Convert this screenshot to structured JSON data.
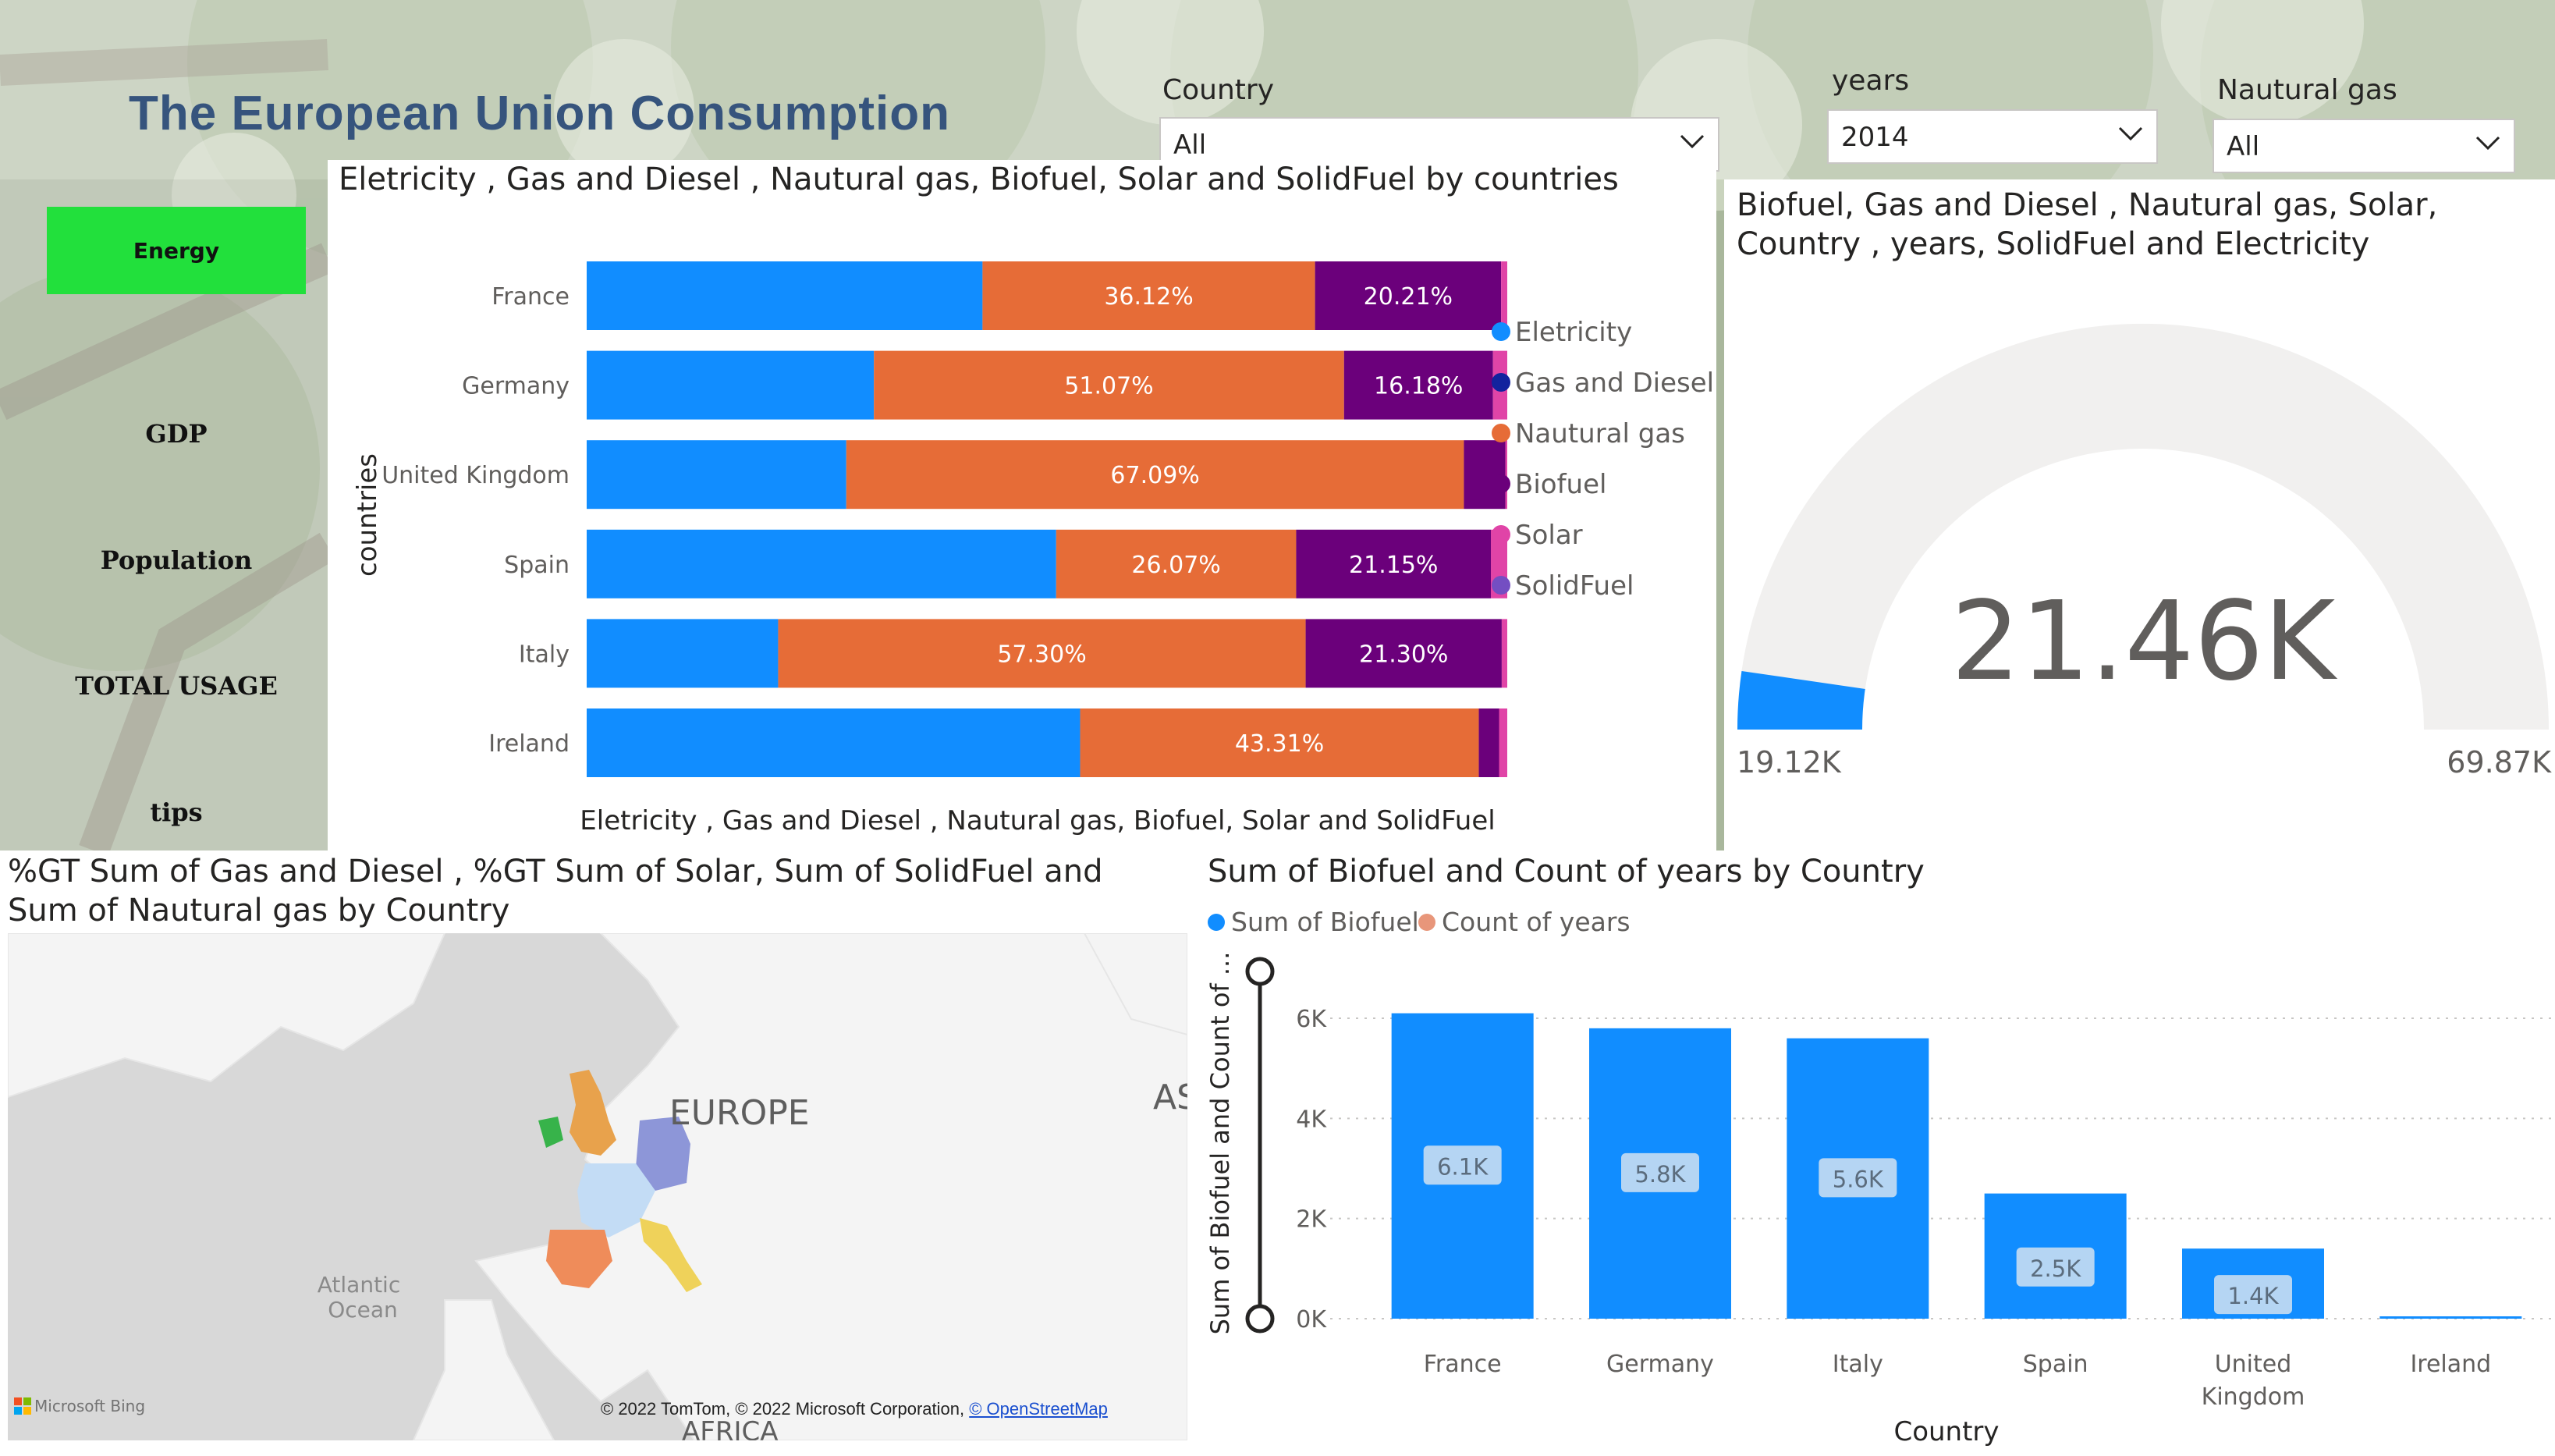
{
  "header": {
    "title": "The European Union Consumption"
  },
  "slicers": {
    "country": {
      "label": "Country",
      "value": "All"
    },
    "years": {
      "label": "years",
      "value": "2014"
    },
    "natural_gas": {
      "label": "Nautural gas",
      "value": "All"
    }
  },
  "nav": {
    "items": [
      "Energy",
      "GDP",
      "Population",
      "TOTAL USAGE",
      "tips"
    ],
    "active": "Energy",
    "active_color": "#22e03c"
  },
  "stacked": {
    "title": "Eletricity , Gas and Diesel , Nautural gas, Biofuel, Solar and SolidFuel by countries",
    "ylabel": "countries",
    "xlabel": "Eletricity , Gas and Diesel , Nautural gas, Biofuel, Solar and SolidFuel",
    "legend": [
      "Eletricity",
      "Gas and Diesel",
      "Nautural gas",
      "Biofuel",
      "Solar",
      "SolidFuel"
    ]
  },
  "gauge": {
    "title": "Biofuel, Gas and Diesel , Nautural gas, Solar, Country , years, SolidFuel and Electricity",
    "value": "21.46K",
    "min": "19.12K",
    "max": "69.87K",
    "value_num": 21460,
    "min_num": 19120,
    "max_num": 69870
  },
  "map": {
    "title": "%GT Sum of Gas and Diesel , %GT Sum of Solar, Sum of SolidFuel and Sum of Nautural gas by Country",
    "labels": {
      "europe": "EUROPE",
      "asia": "AS",
      "ocean1": "Atlantic",
      "ocean2": "Ocean",
      "africa": "AFRICA"
    },
    "bing": "Microsoft Bing",
    "credit": "© 2022 TomTom, © 2022 Microsoft Corporation, ",
    "credit_link": "© OpenStreetMap"
  },
  "bar": {
    "title": "Sum of Biofuel and Count of years by Country",
    "legend": [
      "Sum of Biofuel",
      "Count of years"
    ],
    "ylabel": "Sum of Biofuel and Count of ...",
    "xlabel": "Country"
  },
  "chart_data": [
    {
      "type": "bar",
      "orientation": "horizontal-stacked-100",
      "categories": [
        "France",
        "Germany",
        "United Kingdom",
        "Spain",
        "Italy",
        "Ireland"
      ],
      "series": [
        {
          "name": "Eletricity",
          "color": "#118dff",
          "values": [
            43.0,
            31.2,
            28.2,
            51.0,
            20.8,
            53.6
          ]
        },
        {
          "name": "Gas and Diesel",
          "color": "#12239e",
          "values": [
            0,
            0,
            0,
            0,
            0,
            0
          ]
        },
        {
          "name": "Nautural gas",
          "color": "#e66c37",
          "values": [
            36.12,
            51.07,
            67.09,
            26.07,
            57.3,
            43.31
          ]
        },
        {
          "name": "Biofuel",
          "color": "#6b007b",
          "values": [
            20.21,
            16.18,
            4.5,
            21.15,
            21.3,
            2.2
          ]
        },
        {
          "name": "Solar",
          "color": "#e044a7",
          "values": [
            0.67,
            1.55,
            0.21,
            1.78,
            0.6,
            0.89
          ]
        },
        {
          "name": "SolidFuel",
          "color": "#744ec2",
          "values": [
            0,
            0,
            0,
            0,
            0,
            0
          ]
        }
      ],
      "data_labels": [
        [
          "",
          "36.12%",
          "20.21%"
        ],
        [
          "",
          "51.07%",
          "16.18%"
        ],
        [
          "",
          "67.09%",
          ""
        ],
        [
          "",
          "26.07%",
          "21.15%"
        ],
        [
          "",
          "57.30%",
          "21.30%"
        ],
        [
          "",
          "43.31%",
          ""
        ]
      ],
      "legend_position": "right"
    },
    {
      "type": "bar",
      "categories": [
        "France",
        "Germany",
        "Italy",
        "Spain",
        "United Kingdom",
        "Ireland"
      ],
      "series": [
        {
          "name": "Sum of Biofuel",
          "color": "#118dff",
          "values": [
            6100,
            5800,
            5600,
            2500,
            1400,
            10
          ]
        },
        {
          "name": "Count of years",
          "color": "#e8967a",
          "values": []
        }
      ],
      "data_labels": [
        "6.1K",
        "5.8K",
        "5.6K",
        "2.5K",
        "1.4K",
        ""
      ],
      "yticks": [
        "0K",
        "2K",
        "4K",
        "6K"
      ],
      "ylim": [
        0,
        6000
      ],
      "grid": true,
      "legend_position": "top-left"
    }
  ]
}
